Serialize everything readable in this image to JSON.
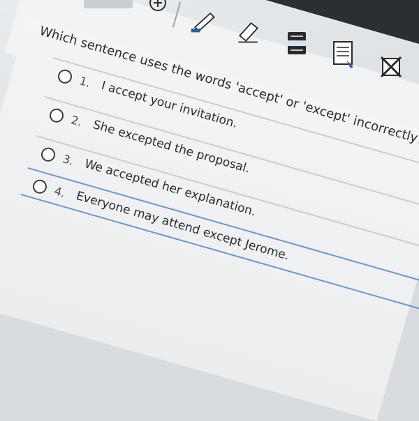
{
  "question": {
    "text": "Which sentence uses the words 'accept' or 'except' incorrectly?"
  },
  "options": [
    {
      "number": "1.",
      "text": "I accept your invitation."
    },
    {
      "number": "2.",
      "text": "She excepted the proposal."
    },
    {
      "number": "3.",
      "text": "We accepted her explanation."
    },
    {
      "number": "4.",
      "text": "Everyone may attend except Jerome."
    }
  ],
  "toolbar": {
    "tools": [
      "add-icon",
      "highlighter-icon",
      "eraser-icon",
      "line-reader-icon",
      "notepad-icon",
      "eliminator-icon"
    ]
  },
  "colors": {
    "accent": "#6d96c9",
    "highlighter": "#2f5f95"
  }
}
